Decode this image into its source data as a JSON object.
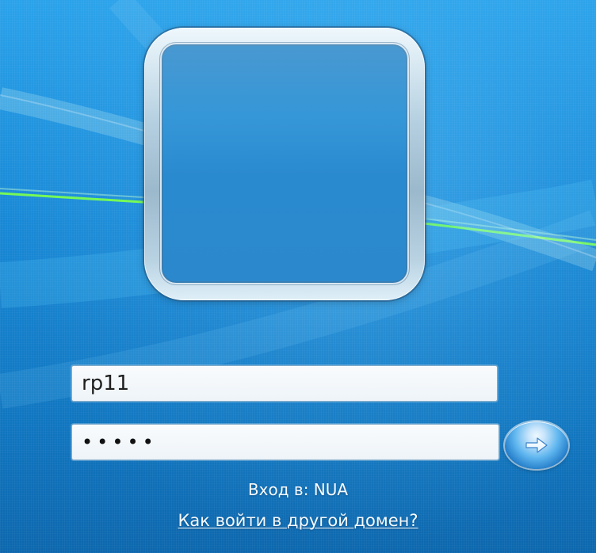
{
  "background": {
    "theme": "windows-7-logon-blue",
    "accent_colors": [
      "#2aa2ea",
      "#1075bf",
      "#7dff4f",
      "#d7ffef"
    ]
  },
  "avatar": {
    "icon": "user-avatar-frame-icon"
  },
  "login_form": {
    "username_value": "rp11",
    "password_value": "•••••",
    "submit_icon": "arrow-right-icon"
  },
  "footer": {
    "domain_label": "Вход в: NUA",
    "alternate_domain_link": "Как войти в другой домен?"
  }
}
